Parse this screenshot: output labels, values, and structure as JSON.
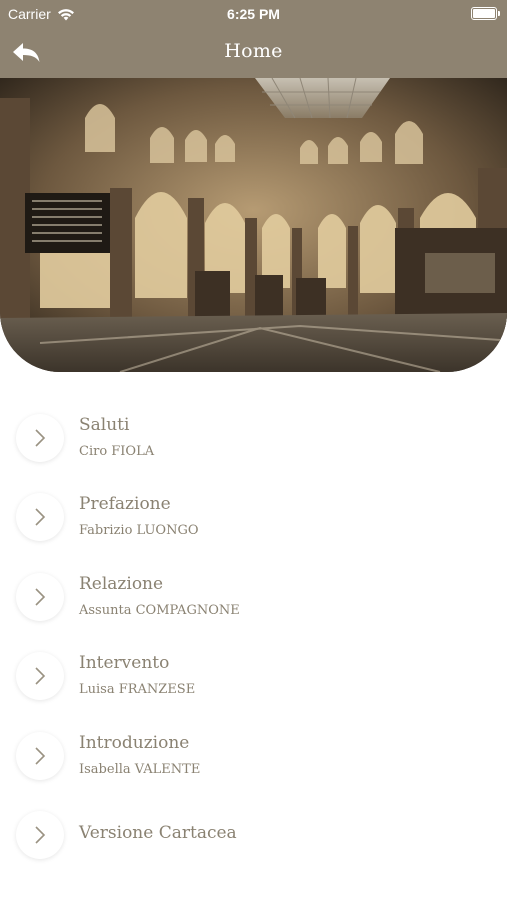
{
  "status_bar": {
    "carrier": "Carrier",
    "time": "6:25 PM",
    "icons": [
      "wifi-icon",
      "battery-icon"
    ]
  },
  "nav_bar": {
    "title": "Home",
    "back_icon": "back-arrow-icon",
    "background_color": "#8e8371"
  },
  "hero_image": {
    "description": "arcaded hall interior with glass ceiling"
  },
  "menu": {
    "chevron_icon": "chevron-right-icon",
    "text_color": "#8a8272",
    "items": [
      {
        "title": "Saluti",
        "subtitle": "Ciro FIOLA"
      },
      {
        "title": "Prefazione",
        "subtitle": "Fabrizio LUONGO"
      },
      {
        "title": "Relazione",
        "subtitle": "Assunta COMPAGNONE"
      },
      {
        "title": "Intervento",
        "subtitle": "Luisa FRANZESE"
      },
      {
        "title": "Introduzione",
        "subtitle": "Isabella VALENTE"
      },
      {
        "title": "Versione Cartacea"
      }
    ]
  }
}
